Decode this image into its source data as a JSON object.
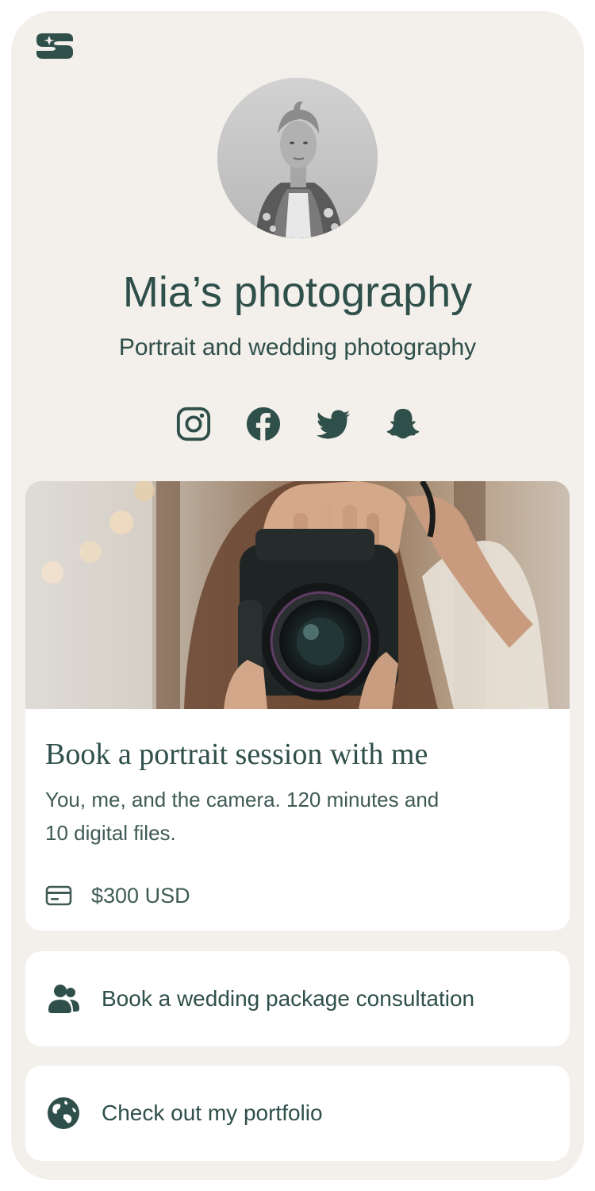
{
  "brand": {
    "logo_icon": "s-logo-icon"
  },
  "profile": {
    "avatar_alt": "profile-photo",
    "name": "Mia’s photography",
    "tagline": "Portrait and wedding photography"
  },
  "socials": [
    {
      "icon": "instagram-icon"
    },
    {
      "icon": "facebook-icon"
    },
    {
      "icon": "twitter-icon"
    },
    {
      "icon": "snapchat-icon"
    }
  ],
  "offer": {
    "title": "Book a portrait session with me",
    "description": "You, me, and the camera. 120 minutes and 10 digital files.",
    "price_icon": "credit-card-icon",
    "price": "$300 USD"
  },
  "links": [
    {
      "icon": "users-icon",
      "label": "Book a wedding package consultation"
    },
    {
      "icon": "globe-icon",
      "label": "Check out my portfolio"
    }
  ],
  "colors": {
    "background": "#f3efeb",
    "card": "#ffffff",
    "primary_text": "#2f4f4a"
  }
}
